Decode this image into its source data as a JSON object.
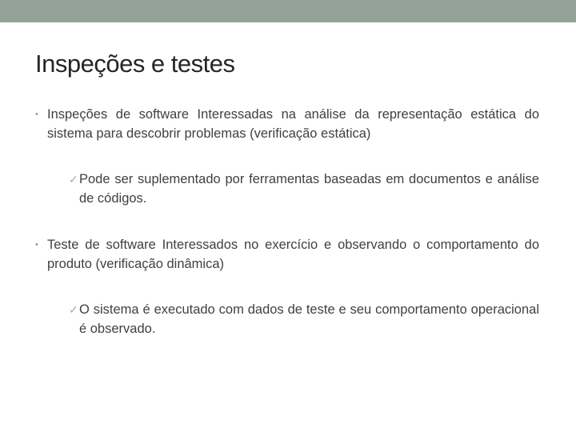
{
  "slide": {
    "title": "Inspeções e testes",
    "bullets": [
      {
        "marker": "•",
        "text": "Inspeções de software Interessadas na análise da representação estática do sistema para descobrir problemas (verificação estática)",
        "sub": {
          "marker": "✓",
          "text": "Pode ser suplementado por ferramentas baseadas em documentos e análise de códigos."
        }
      },
      {
        "marker": "•",
        "text": "Teste de software Interessados no exercício e observando o comportamento do produto (verificação dinâmica)",
        "sub": {
          "marker": "✓",
          "text": "O sistema é executado com dados de teste e seu comportamento operacional é observado."
        }
      }
    ]
  }
}
